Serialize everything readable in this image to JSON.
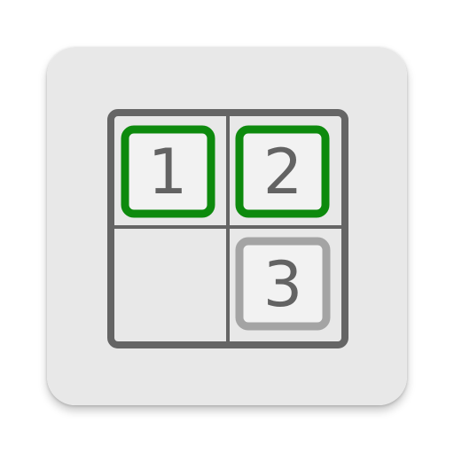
{
  "colors": {
    "tile_background": "#e8e8e8",
    "grid_border": "#656565",
    "tile_fill": "#f2f2f2",
    "solved_border": "#0d8a0d",
    "unsolved_border": "#a4a4a4",
    "digit_color": "#636363"
  },
  "board": {
    "cells": [
      {
        "value": "1",
        "state": "solved"
      },
      {
        "value": "2",
        "state": "solved"
      },
      {
        "value": "",
        "state": "empty"
      },
      {
        "value": "3",
        "state": "unsolved"
      }
    ]
  }
}
